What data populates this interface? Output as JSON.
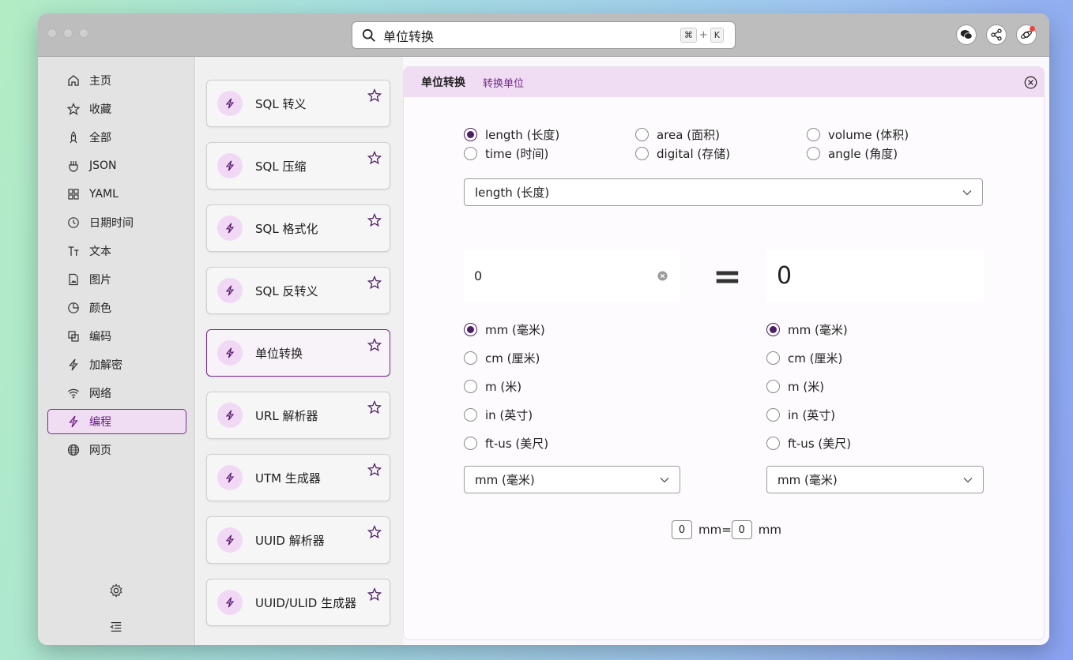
{
  "search": {
    "value": "单位转换",
    "shortcut_key1": "⌘",
    "shortcut_plus": "+",
    "shortcut_key2": "K"
  },
  "sidebar": {
    "items": [
      {
        "label": "主页",
        "icon": "home-icon"
      },
      {
        "label": "收藏",
        "icon": "star-icon"
      },
      {
        "label": "全部",
        "icon": "rocket-icon"
      },
      {
        "label": "JSON",
        "icon": "json-icon"
      },
      {
        "label": "YAML",
        "icon": "grid-icon"
      },
      {
        "label": "日期时间",
        "icon": "clock-icon"
      },
      {
        "label": "文本",
        "icon": "text-icon"
      },
      {
        "label": "图片",
        "icon": "image-icon"
      },
      {
        "label": "颜色",
        "icon": "palette-icon"
      },
      {
        "label": "编码",
        "icon": "copy-icon"
      },
      {
        "label": "加解密",
        "icon": "bolt-icon"
      },
      {
        "label": "网络",
        "icon": "wifi-icon"
      },
      {
        "label": "编程",
        "icon": "bolt-icon",
        "active": true
      },
      {
        "label": "网页",
        "icon": "globe-icon"
      }
    ]
  },
  "tools": [
    {
      "label": "SQL 转义"
    },
    {
      "label": "SQL 压缩"
    },
    {
      "label": "SQL 格式化"
    },
    {
      "label": "SQL 反转义"
    },
    {
      "label": "单位转换",
      "active": true
    },
    {
      "label": "URL 解析器"
    },
    {
      "label": "UTM 生成器"
    },
    {
      "label": "UUID 解析器"
    },
    {
      "label": "UUID/ULID 生成器"
    }
  ],
  "panel": {
    "title": "单位转换",
    "subtitle": "转换单位",
    "categories": [
      {
        "label": "length (长度)",
        "checked": true
      },
      {
        "label": "area (面积)"
      },
      {
        "label": "volume (体积)"
      },
      {
        "label": "time (时间)"
      },
      {
        "label": "digital (存储)"
      },
      {
        "label": "angle (角度)"
      }
    ],
    "category_select": "length (长度)",
    "input_value": "0",
    "equals": "=",
    "output_value": "0",
    "from_units": [
      {
        "label": "mm (毫米)",
        "checked": true
      },
      {
        "label": "cm (厘米)"
      },
      {
        "label": "m (米)"
      },
      {
        "label": "in (英寸)"
      },
      {
        "label": "ft-us (美尺)"
      }
    ],
    "to_units": [
      {
        "label": "mm (毫米)",
        "checked": true
      },
      {
        "label": "cm (厘米)"
      },
      {
        "label": "m (米)"
      },
      {
        "label": "in (英寸)"
      },
      {
        "label": "ft-us (美尺)"
      }
    ],
    "from_select": "mm (毫米)",
    "to_select": "mm (毫米)",
    "summary": {
      "left_value": "0",
      "left_unit": "mm=",
      "right_value": "0",
      "right_unit": "mm"
    }
  },
  "colors": {
    "accent": "#6a1b83",
    "accent_bg": "#f0ddf4",
    "badge": "#f1d9f6"
  }
}
